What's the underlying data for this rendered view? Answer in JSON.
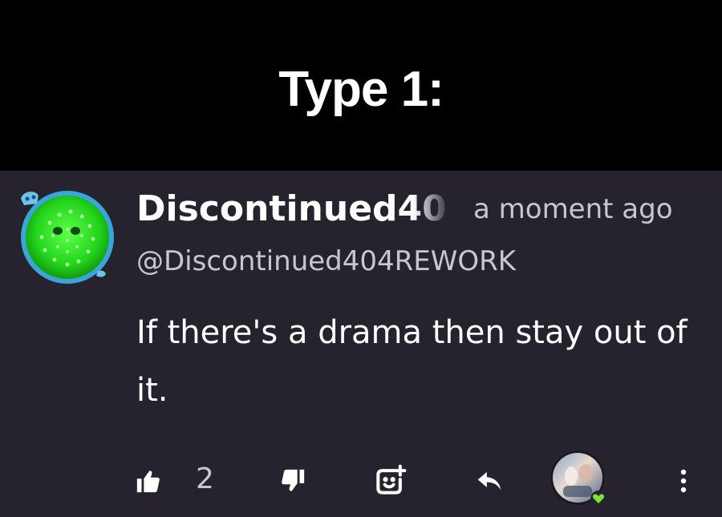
{
  "banner": {
    "title": "Type 1:"
  },
  "comment": {
    "author": "Discontinued40",
    "timestamp": "a moment ago",
    "handle": "@Discontinued404REWORK",
    "text": "If there's a drama then stay out of it.",
    "avatar_icon": "green-dotted-circle-avatar"
  },
  "actions": {
    "like_count": "2",
    "like_icon": "thumbs-up-icon",
    "dislike_icon": "thumbs-down-icon",
    "emoji_icon": "add-reaction-icon",
    "reply_icon": "reply-arrow-icon",
    "creator_avatar_icon": "creator-heart-avatar",
    "more_icon": "more-vertical-icon"
  },
  "colors": {
    "banner_bg": "#000000",
    "comment_bg": "#26232e",
    "primary_text": "#ffffff",
    "secondary_text": "#c8c6cf",
    "avatar_green": "#22d41a",
    "avatar_ring": "#3aa6d8",
    "heart_green": "#7ee03a"
  }
}
